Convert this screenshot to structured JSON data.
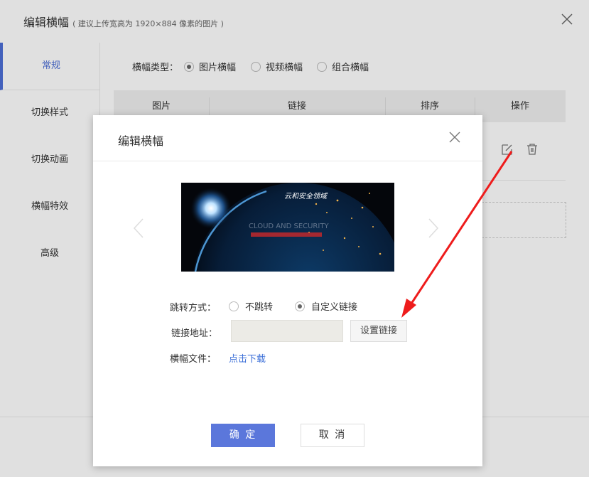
{
  "outer": {
    "title": "编辑横幅",
    "title_hint": "( 建议上传宽高为 1920×884 像素的图片 )",
    "sidebar": [
      {
        "label": "常规",
        "active": true
      },
      {
        "label": "切换样式",
        "active": false
      },
      {
        "label": "切换动画",
        "active": false
      },
      {
        "label": "横幅特效",
        "active": false
      },
      {
        "label": "高级",
        "active": false
      }
    ],
    "banner_type_label": "横幅类型：",
    "banner_type_options": [
      "图片横幅",
      "视频横幅",
      "组合横幅"
    ],
    "table_headers": [
      "图片",
      "链接",
      "排序",
      "操作"
    ]
  },
  "modal": {
    "title": "编辑横幅",
    "banner_text": "云和安全领域",
    "banner_subtext": "CLOUD AND SECURITY",
    "jump_label": "跳转方式：",
    "jump_options": [
      "不跳转",
      "自定义链接"
    ],
    "link_label": "链接地址：",
    "link_value": "",
    "set_link_button": "设置链接",
    "file_label": "横幅文件：",
    "download_link": "点击下载",
    "ok_button": "确 定",
    "cancel_button": "取 消"
  },
  "colors": {
    "accent": "#5b77db",
    "link": "#3b6fd8",
    "annotation_arrow": "#ee1c1c"
  }
}
